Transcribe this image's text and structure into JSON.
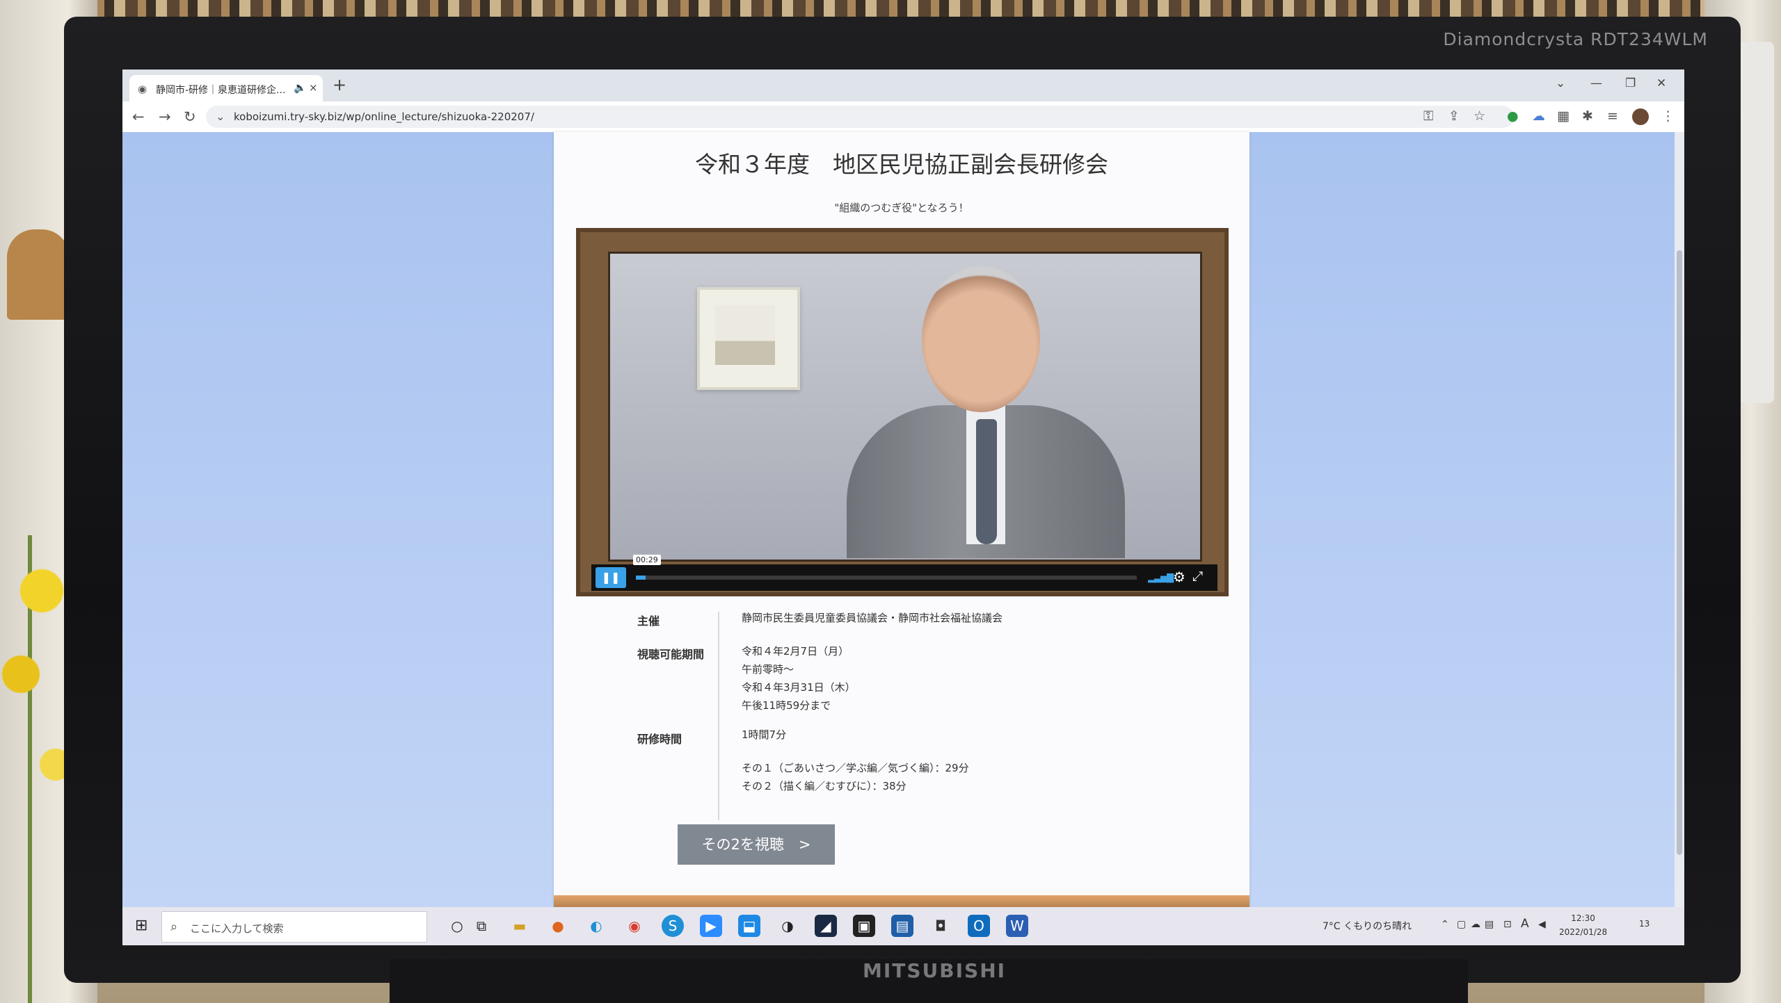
{
  "monitor": {
    "model": "Diamondcrysta RDT234WLM",
    "brand": "MITSUBISHI"
  },
  "browser": {
    "tab": {
      "title": "静岡市-研修｜泉恵道研修企...",
      "audio_icon": "speaker-icon",
      "close": "×"
    },
    "new_tab": "+",
    "url": "koboizumi.try-sky.biz/wp/online_lecture/shizuoka-220207/",
    "window_controls": [
      "⌄",
      "—",
      "❐",
      "✕"
    ]
  },
  "page": {
    "title": "令和３年度　地区民児協正副会長研修会",
    "subtitle": "\"組織のつむぎ役\"となろう！",
    "player": {
      "time_tooltip": "00:29",
      "play_state_icon": "pause-icon",
      "progress": 0.02,
      "accent_color": "#3aa1e6"
    },
    "info": {
      "host_label": "主催",
      "host_value": "静岡市民生委員児童委員協議会・静岡市社会福祉協議会",
      "period_label": "視聴可能期間",
      "period_lines": [
        "令和４年2月7日（月）",
        "午前零時～",
        "令和４年3月31日（木）",
        "午後11時59分まで"
      ],
      "duration_label": "研修時間",
      "duration_total": "1時間7分",
      "duration_parts": [
        "その１（ごあいさつ／学ぶ編／気づく編）：29分",
        "その２（描く編／むすびに）：38分"
      ]
    },
    "watch_button": "その2を視聴　>"
  },
  "taskbar": {
    "search_placeholder": "ここに入力して検索",
    "weather": "7°C くもりのち晴れ",
    "ime": "A",
    "time": "12:30",
    "date": "2022/01/28",
    "notifications": "13"
  }
}
